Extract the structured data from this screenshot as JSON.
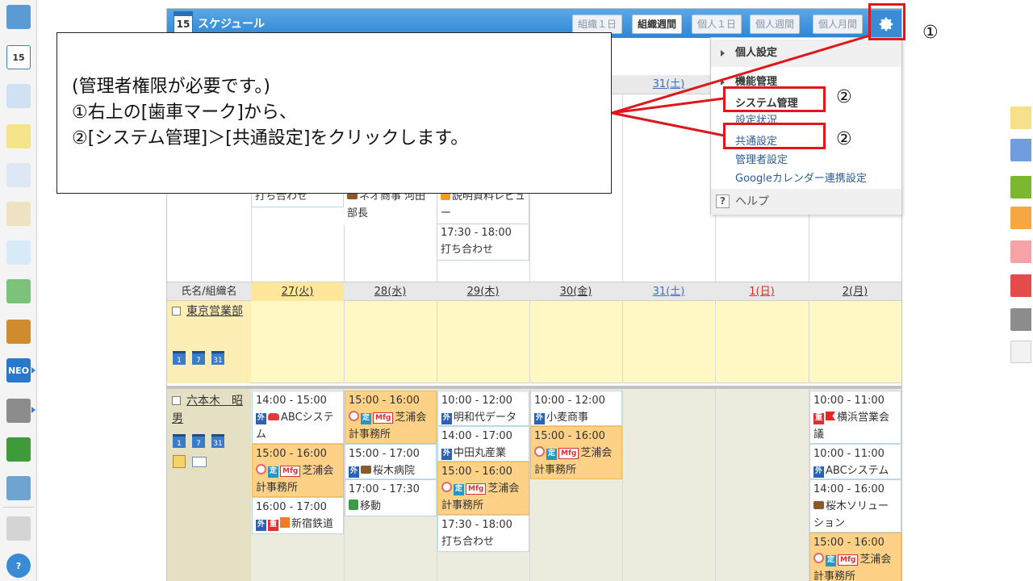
{
  "sidebar": {
    "icons": [
      "dashboard-icon",
      "calendar-icon",
      "facility-icon",
      "memo-icon",
      "bulletin-icon",
      "clipboard-icon",
      "search-doc-icon",
      "refresh-doc-icon",
      "cabinet-icon",
      "neo-chart-icon",
      "folder-icon",
      "tanomaru-icon",
      "app-banner-icon",
      "gear-icon",
      "help-icon"
    ],
    "calendar_day": "15",
    "neo_label": "NEO"
  },
  "app": {
    "title": "スケジュール",
    "icon_day": "15"
  },
  "view_tabs": [
    "組織１日",
    "組織週間",
    "個人１日",
    "個人週間",
    "個人月間"
  ],
  "active_tab": "組織週間",
  "upper_events": {
    "col2_line1": "ネオ商事 河田",
    "col2_line2": "部長",
    "col3_line1": "説明資料レビュ",
    "col3_line2": "ー",
    "col3_time": "17:30 - 18:00",
    "col3_title": "打ち合わせ",
    "col1_title": "打ち合わせ",
    "day_31": "31(土)"
  },
  "table": {
    "name_header": "氏名/組織名",
    "days": [
      "27(火)",
      "28(水)",
      "29(木)",
      "30(金)",
      "31(土)",
      "1(日)",
      "2(月)"
    ]
  },
  "group": {
    "name": "東京営業部",
    "cal_icons": [
      "1",
      "7",
      "31"
    ]
  },
  "person": {
    "name": "六本木　昭男",
    "cal_icons": [
      "1",
      "7",
      "31"
    ]
  },
  "events": {
    "tue": [
      {
        "time": "14:00 - 15:00",
        "badge": "外",
        "title": "ABCシステム"
      },
      {
        "time": "15:00 - 16:00",
        "badge": "定",
        "mark": "Mfg",
        "title": "芝浦会計事務所"
      },
      {
        "time": "16:00 - 17:00",
        "badge": "外",
        "badge2": "重",
        "title": "新宿鉄道"
      }
    ],
    "wed": [
      {
        "time": "15:00 - 16:00",
        "badge": "定",
        "mark": "Mfg",
        "title": "芝浦会計事務所"
      },
      {
        "time": "15:00 - 17:00",
        "badge": "外",
        "title": "桜木病院"
      },
      {
        "time": "17:00 - 17:30",
        "title": "移動"
      }
    ],
    "thu": [
      {
        "time": "10:00 - 12:00",
        "badge": "外",
        "title": "明和代データ"
      },
      {
        "time": "14:00 - 17:00",
        "badge": "外",
        "title": "中田丸産業"
      },
      {
        "time": "15:00 - 16:00",
        "badge": "定",
        "mark": "Mfg",
        "title": "芝浦会計事務所"
      },
      {
        "time": "17:30 - 18:00",
        "title": "打ち合わせ"
      }
    ],
    "fri": [
      {
        "time": "10:00 - 12:00",
        "badge": "外",
        "title": "小麦商事"
      },
      {
        "time": "15:00 - 16:00",
        "badge": "定",
        "mark": "Mfg",
        "title": "芝浦会計事務所"
      }
    ],
    "mon": [
      {
        "time": "10:00 - 11:00",
        "badge": "重",
        "title": "横浜営業会議"
      },
      {
        "time": "10:00 - 11:00",
        "badge": "外",
        "title": "ABCシステム"
      },
      {
        "time": "14:00 - 16:00",
        "title": "桜木ソリューション"
      },
      {
        "time": "15:00 - 16:00",
        "badge": "定",
        "mark": "Mfg",
        "title": "芝浦会計事務所"
      }
    ]
  },
  "dropdown": {
    "personal": "個人設定",
    "function": "機能管理",
    "system": "システム管理",
    "settings_status": "設定状況",
    "common": "共通設定",
    "admin": "管理者設定",
    "google": "Googleカレンダー連携設定",
    "help": "ヘルプ",
    "help_glyph": "?"
  },
  "callout": {
    "line1": "(管理者権限が必要です。)",
    "line2": "①右上の[歯車マーク]から、",
    "line3": "②[システム管理]＞[共通設定]をクリックします。"
  },
  "steps": {
    "one": "①",
    "two": "②"
  },
  "colors": {
    "highlight": "#e0161a",
    "title_bar": "#3a8bd6",
    "today": "#ffe79a"
  }
}
